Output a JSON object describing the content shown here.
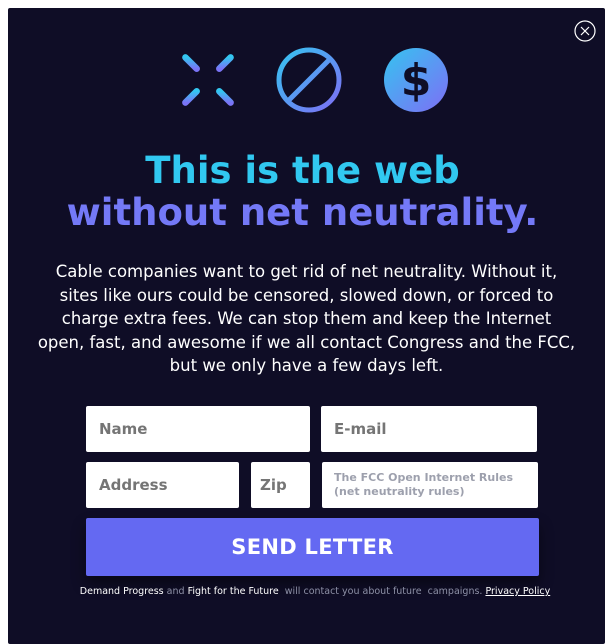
{
  "modal": {
    "icons": [
      "loading-spinner-icon",
      "prohibited-icon",
      "dollar-icon"
    ],
    "dollar_glyph": "$",
    "close_icon": "close-icon"
  },
  "headline": {
    "line1": "This is the web",
    "line2": "without net neutrality."
  },
  "body": {
    "text": "Cable companies want to get rid of net neutrality. Without it, sites like ours could be censored, slowed down, or forced to charge extra fees. We can stop them and keep the Internet open, fast, and awesome if we all contact Congress and the FCC, but we only have a few days left."
  },
  "form": {
    "name_placeholder": "Name",
    "email_placeholder": "E-mail",
    "address_placeholder": "Address",
    "zip_placeholder": "Zip",
    "comment_placeholder": "The FCC Open Internet Rules (net neutrality rules)",
    "send_label": "SEND LETTER"
  },
  "disclaimer": {
    "org1": "Demand Progress",
    "and": " and ",
    "org2": "Fight for the Future",
    "text": "  will contact you about future  campaigns. ",
    "privacy": "Privacy Policy"
  },
  "colors": {
    "background": "#0f0d26",
    "cyan": "#31c8f0",
    "purple": "#7479f7",
    "button": "#6469f2"
  }
}
